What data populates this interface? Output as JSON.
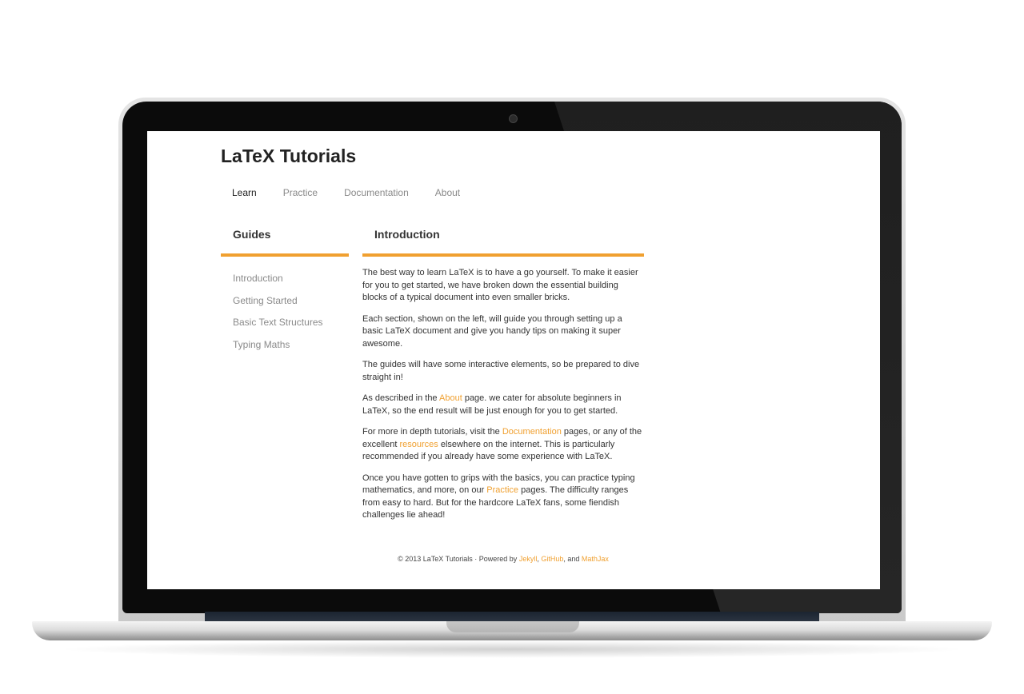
{
  "site": {
    "title": "LaTeX Tutorials"
  },
  "nav": {
    "items": [
      {
        "label": "Learn"
      },
      {
        "label": "Practice"
      },
      {
        "label": "Documentation"
      },
      {
        "label": "About"
      }
    ]
  },
  "sidebar": {
    "heading": "Guides",
    "items": [
      {
        "label": "Introduction"
      },
      {
        "label": "Getting Started"
      },
      {
        "label": "Basic Text Structures"
      },
      {
        "label": "Typing Maths"
      }
    ]
  },
  "main": {
    "heading": "Introduction",
    "p1": "The best way to learn LaTeX is to have a go yourself. To make it easier for you to get started, we have broken down the essential building blocks of a typical document into even smaller bricks.",
    "p2": "Each section, shown on the left, will guide you through setting up a basic LaTeX document and give you handy tips on making it super awesome.",
    "p3": "The guides will have some interactive elements, so be prepared to dive straight in!",
    "p4": {
      "before": "As described in the ",
      "link": "About",
      "after": " page. we cater for absolute beginners in LaTeX, so the end result will be just enough for you to get started."
    },
    "p5": {
      "before": "For more in depth tutorials, visit the ",
      "link1": "Documentation",
      "middle": " pages, or any of the excellent ",
      "link2": "resources",
      "after": " elsewhere on the internet. This is particularly recommended if you already have some experience with LaTeX."
    },
    "p6": {
      "before": "Once you have gotten to grips with the basics, you can practice typing mathematics, and more, on our ",
      "link": "Practice",
      "after": " pages. The difficulty ranges from easy to hard. But for the hardcore LaTeX fans, some fiendish challenges lie ahead!"
    }
  },
  "footer": {
    "prefix": "© 2013 LaTeX Tutorials · Powered by ",
    "link1": "Jekyll",
    "sep1": ", ",
    "link2": "GitHub",
    "sep2": ", and ",
    "link3": "MathJax"
  },
  "colors": {
    "accent": "#f0a030",
    "text": "#333333",
    "muted": "#8a8a8a"
  }
}
